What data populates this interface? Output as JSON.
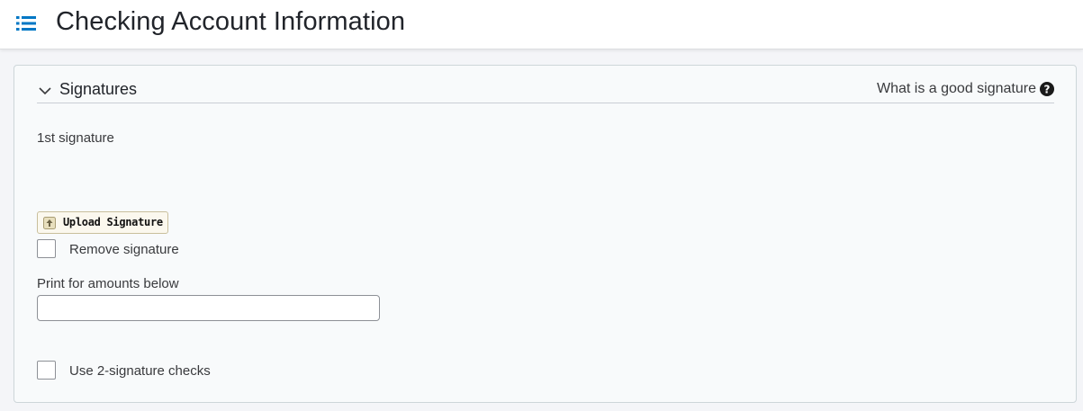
{
  "header": {
    "title": "Checking Account Information",
    "menu_icon": "list-icon",
    "accent_color": "#0077c5"
  },
  "signatures_section": {
    "title": "Signatures",
    "collapse_icon": "chevron-down-icon",
    "help_link": "What is a good signature",
    "help_icon": "question-circle-icon",
    "first_signature_label": "1st signature",
    "upload_button_label": "Upload Signature",
    "upload_icon": "arrow-up-icon",
    "remove_signature": {
      "label": "Remove signature",
      "checked": false
    },
    "print_amounts": {
      "label": "Print for amounts below",
      "value": "",
      "placeholder": ""
    },
    "two_signature": {
      "label": "Use 2-signature checks",
      "checked": false
    }
  }
}
